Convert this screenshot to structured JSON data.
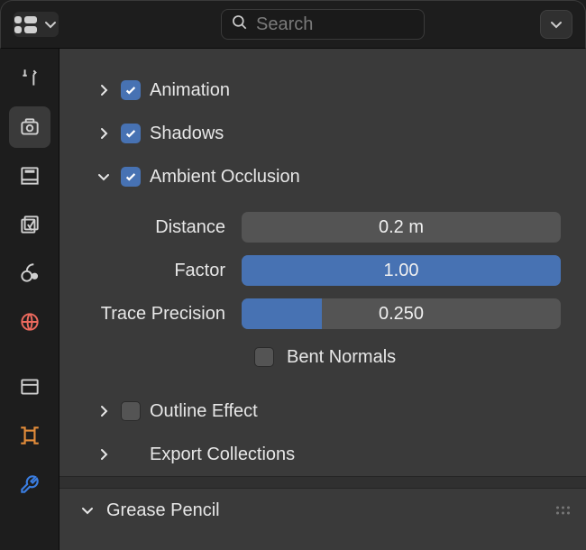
{
  "search": {
    "placeholder": "Search",
    "value": ""
  },
  "sections": {
    "animation": {
      "label": "Animation",
      "checked": true,
      "expanded": false
    },
    "shadows": {
      "label": "Shadows",
      "checked": true,
      "expanded": false
    },
    "ao": {
      "label": "Ambient Occlusion",
      "checked": true,
      "expanded": true,
      "props": {
        "distance": {
          "label": "Distance",
          "value": "0.2 m",
          "fill_pct": 0
        },
        "factor": {
          "label": "Factor",
          "value": "1.00",
          "fill_pct": 100
        },
        "trace": {
          "label": "Trace Precision",
          "value": "0.250",
          "fill_pct": 25
        },
        "bent": {
          "label": "Bent Normals",
          "checked": false
        }
      }
    },
    "outline": {
      "label": "Outline Effect",
      "checked": false,
      "expanded": false
    },
    "export": {
      "label": "Export Collections",
      "expanded": false
    },
    "grease": {
      "label": "Grease Pencil",
      "expanded": true
    }
  }
}
